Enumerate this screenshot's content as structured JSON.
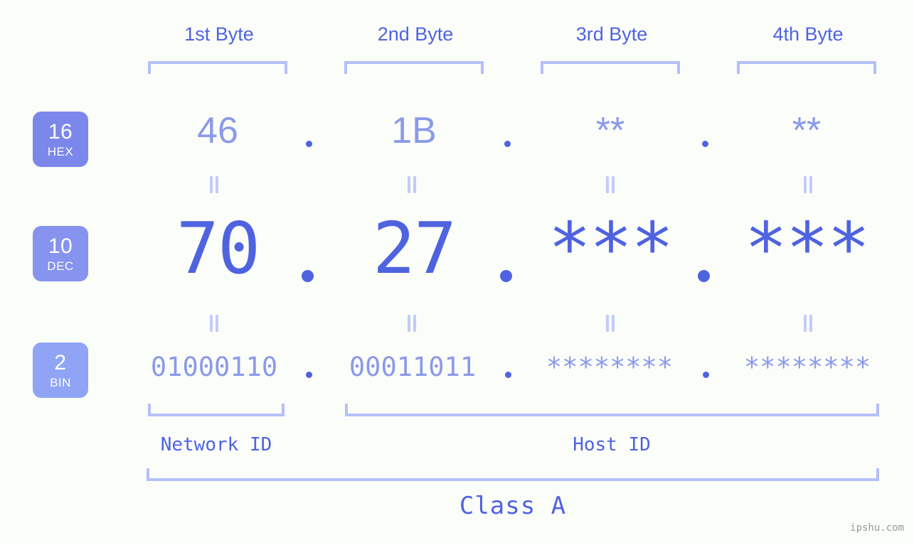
{
  "meta": {
    "watermark": "ipshu.com"
  },
  "headers": [
    {
      "label": "1st Byte"
    },
    {
      "label": "2nd Byte"
    },
    {
      "label": "3rd Byte"
    },
    {
      "label": "4th Byte"
    }
  ],
  "rows": [
    {
      "id": "hex",
      "base": "16",
      "base_name": "HEX",
      "badge_color": "#7b87ea",
      "octets": [
        "46",
        "1B",
        "**",
        "**"
      ],
      "separator": "."
    },
    {
      "id": "dec",
      "base": "10",
      "base_name": "DEC",
      "badge_color": "#8693ef",
      "octets": [
        "70",
        "27",
        "***",
        "***"
      ],
      "separator": "."
    },
    {
      "id": "bin",
      "base": "2",
      "base_name": "BIN",
      "badge_color": "#8fa4f5",
      "octets": [
        "01000110",
        "00011011",
        "********",
        "********"
      ],
      "separator": "."
    }
  ],
  "equals_marker": "=",
  "segments": {
    "network_id": "Network ID",
    "host_id": "Host ID",
    "class": "Class A"
  },
  "colors": {
    "background": "#fbfdf9",
    "accent_strong": "#4f63e0",
    "accent_light": "#8b9ae8",
    "bracket": "#b5bff8",
    "equals": "#c3cbfb",
    "watermark": "#9a9a9a"
  }
}
